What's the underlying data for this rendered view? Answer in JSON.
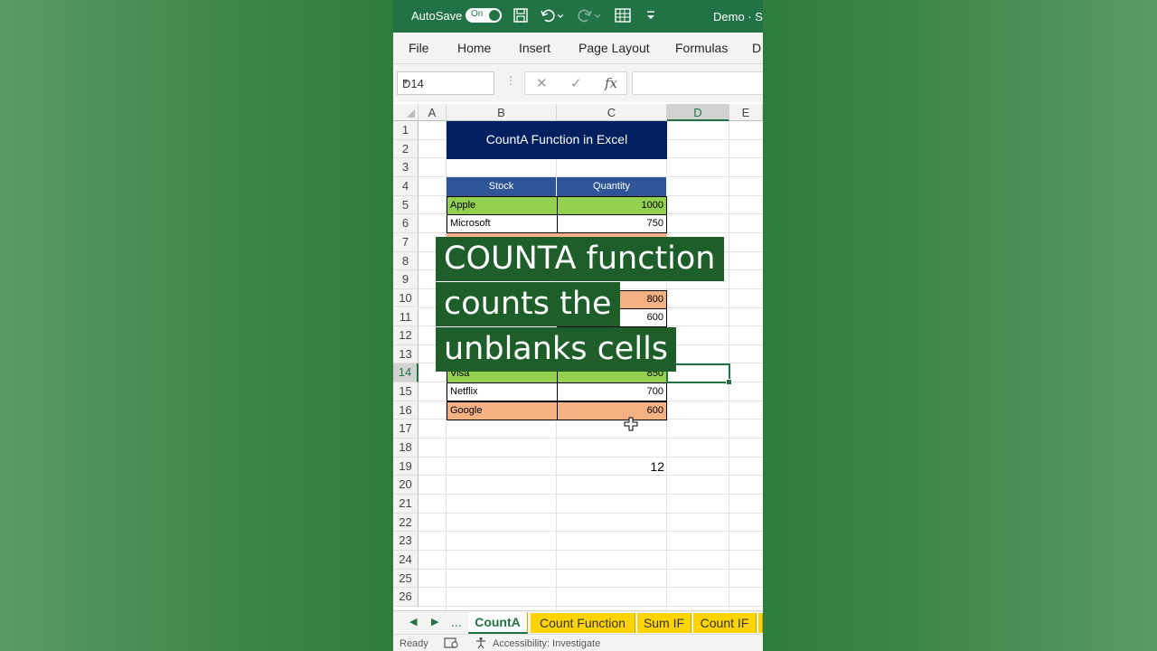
{
  "titlebar": {
    "autosave_label": "AutoSave",
    "autosave_state": "On",
    "document": "Demo · S"
  },
  "ribbon": {
    "tabs": [
      "File",
      "Home",
      "Insert",
      "Page Layout",
      "Formulas",
      "D"
    ]
  },
  "formula_bar": {
    "name_box": "D14",
    "cancel_icon": "✕",
    "enter_icon": "✓",
    "fx_label": "fx",
    "formula": ""
  },
  "columns": [
    "A",
    "B",
    "C",
    "D",
    "E"
  ],
  "selected_column": "D",
  "rows": [
    "1",
    "2",
    "3",
    "4",
    "5",
    "6",
    "7",
    "8",
    "9",
    "10",
    "11",
    "12",
    "13",
    "14",
    "15",
    "16",
    "17",
    "18",
    "19",
    "20",
    "21",
    "22",
    "23",
    "24",
    "25",
    "26"
  ],
  "selected_row": "14",
  "sheet": {
    "title": "CountA Function in Excel",
    "headers": {
      "stock": "Stock",
      "quantity": "Quantity"
    },
    "data": [
      {
        "row": 5,
        "stock": "Apple",
        "quantity": "1000"
      },
      {
        "row": 6,
        "stock": "Microsoft",
        "quantity": "750"
      },
      {
        "row": 10,
        "stock": "",
        "quantity": "800"
      },
      {
        "row": 11,
        "stock": "",
        "quantity": "600"
      },
      {
        "row": 14,
        "stock": "Visa",
        "quantity": "850"
      },
      {
        "row": 15,
        "stock": "Netflix",
        "quantity": "700"
      },
      {
        "row": 16,
        "stock": "Google",
        "quantity": "600"
      }
    ],
    "result_value": "12"
  },
  "caption": {
    "lines": [
      "COUNTA function",
      "counts the",
      "unblanks cells"
    ]
  },
  "sheet_tabs": {
    "nav_prev": "◀",
    "nav_next": "▶",
    "more": "...",
    "tabs": [
      "CountA",
      "Count Function",
      "Sum IF",
      "Count IF"
    ],
    "active": "CountA"
  },
  "status": {
    "ready": "Ready",
    "accessibility": "Accessibility: Investigate"
  },
  "colors": {
    "excel_green": "#217346",
    "title_fill": "#002060",
    "header_fill": "#2f5597",
    "green_fill": "#92d050",
    "salmon_fill": "#f4b183",
    "tab_yellow": "#ffd400"
  }
}
